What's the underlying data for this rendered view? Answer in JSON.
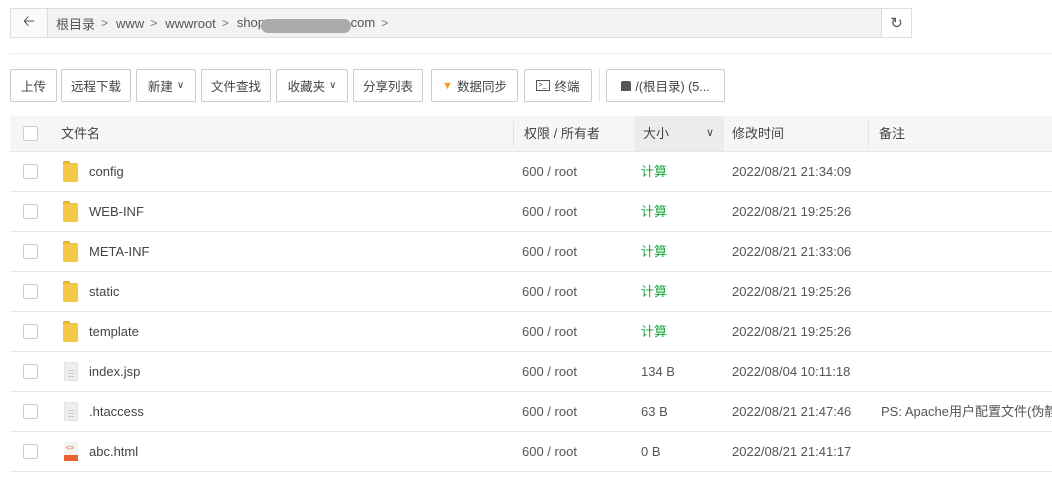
{
  "breadcrumb": {
    "items": [
      "根目录",
      "www",
      "wwwroot"
    ],
    "last_prefix": "shop",
    "last_suffix": ".com"
  },
  "toolbar": {
    "upload": "上传",
    "remote_download": "远程下载",
    "new": "新建",
    "find": "文件查找",
    "favorites": "收藏夹",
    "share_list": "分享列表",
    "sync": "数据同步",
    "terminal": "终端",
    "disk": "/(根目录) (5..."
  },
  "table": {
    "headers": {
      "name": "文件名",
      "perm": "权限 / 所有者",
      "size": "大小",
      "mtime": "修改时间",
      "note": "备注"
    },
    "rows": [
      {
        "type": "folder",
        "name": "config",
        "perm": "600 / root",
        "size": "计算",
        "mtime": "2022/08/21 21:34:09",
        "note": ""
      },
      {
        "type": "folder",
        "name": "WEB-INF",
        "perm": "600 / root",
        "size": "计算",
        "mtime": "2022/08/21 19:25:26",
        "note": ""
      },
      {
        "type": "folder",
        "name": "META-INF",
        "perm": "600 / root",
        "size": "计算",
        "mtime": "2022/08/21 21:33:06",
        "note": ""
      },
      {
        "type": "folder",
        "name": "static",
        "perm": "600 / root",
        "size": "计算",
        "mtime": "2022/08/21 19:25:26",
        "note": ""
      },
      {
        "type": "folder",
        "name": "template",
        "perm": "600 / root",
        "size": "计算",
        "mtime": "2022/08/21 19:25:26",
        "note": ""
      },
      {
        "type": "file",
        "name": "index.jsp",
        "perm": "600 / root",
        "size": "134 B",
        "mtime": "2022/08/04 10:11:18",
        "note": ""
      },
      {
        "type": "file",
        "name": ".htaccess",
        "perm": "600 / root",
        "size": "63 B",
        "mtime": "2022/08/21 21:47:46",
        "note": "PS: Apache用户配置文件(伪静态)"
      },
      {
        "type": "html",
        "name": "abc.html",
        "perm": "600 / root",
        "size": "0 B",
        "mtime": "2022/08/21 21:41:17",
        "note": ""
      }
    ]
  }
}
